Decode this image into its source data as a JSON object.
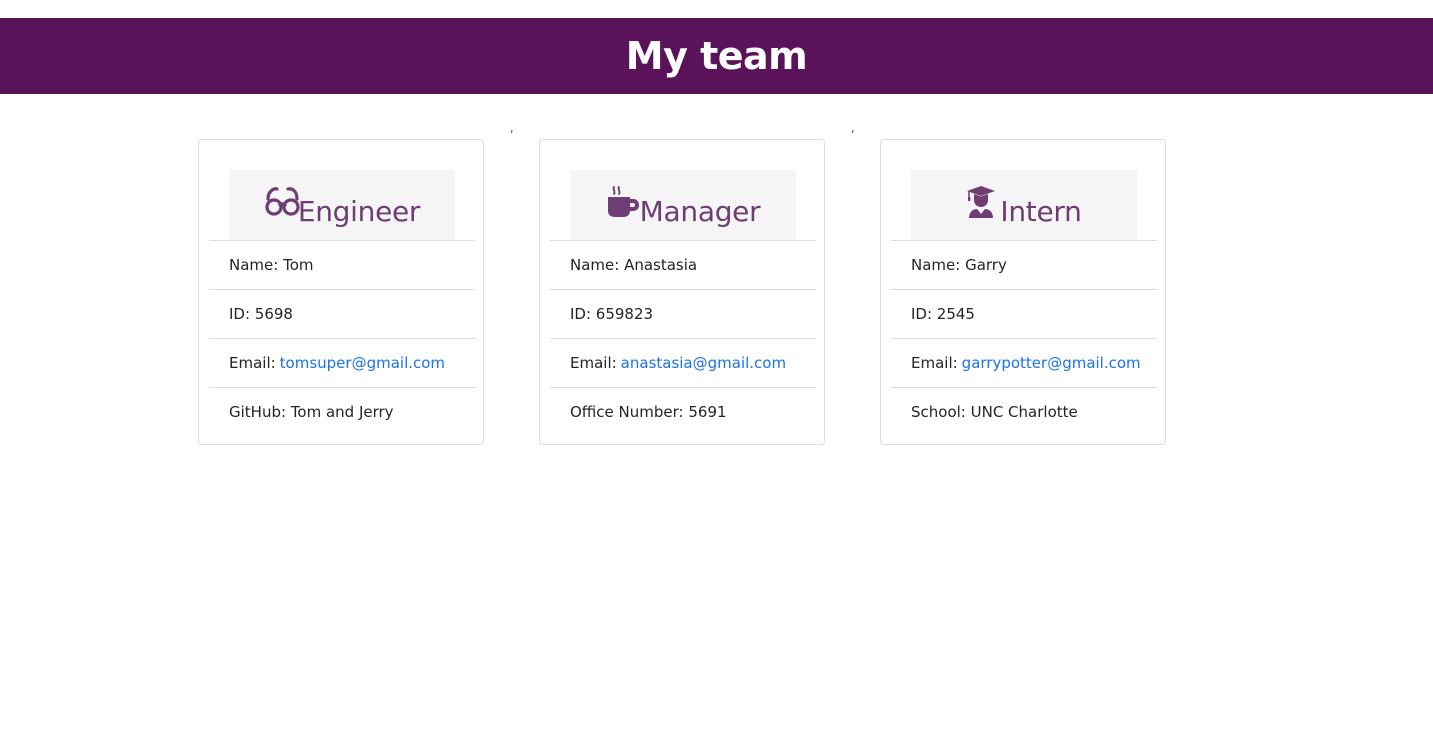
{
  "page": {
    "title": "My team"
  },
  "colors": {
    "header_bg": "#5a1259",
    "role_text": "#6e3d74",
    "link": "#1a73e8"
  },
  "separators": [
    ",",
    ","
  ],
  "cards": [
    {
      "role": "Engineer",
      "icon": "glasses-icon",
      "name_label": "Name: Tom",
      "id_label": "ID: 5698",
      "email_prefix": "Email:",
      "email": "tomsuper@gmail.com",
      "extra_label": "GitHub: Tom and Jerry"
    },
    {
      "role": "Manager",
      "icon": "mug-hot-icon",
      "name_label": "Name: Anastasia",
      "id_label": "ID: 659823",
      "email_prefix": "Email:",
      "email": "anastasia@gmail.com",
      "extra_label": "Office Number: 5691"
    },
    {
      "role": "Intern",
      "icon": "user-graduate-icon",
      "name_label": "Name: Garry",
      "id_label": "ID: 2545",
      "email_prefix": "Email:",
      "email": "garrypotter@gmail.com",
      "extra_label": "School: UNC Charlotte"
    }
  ]
}
